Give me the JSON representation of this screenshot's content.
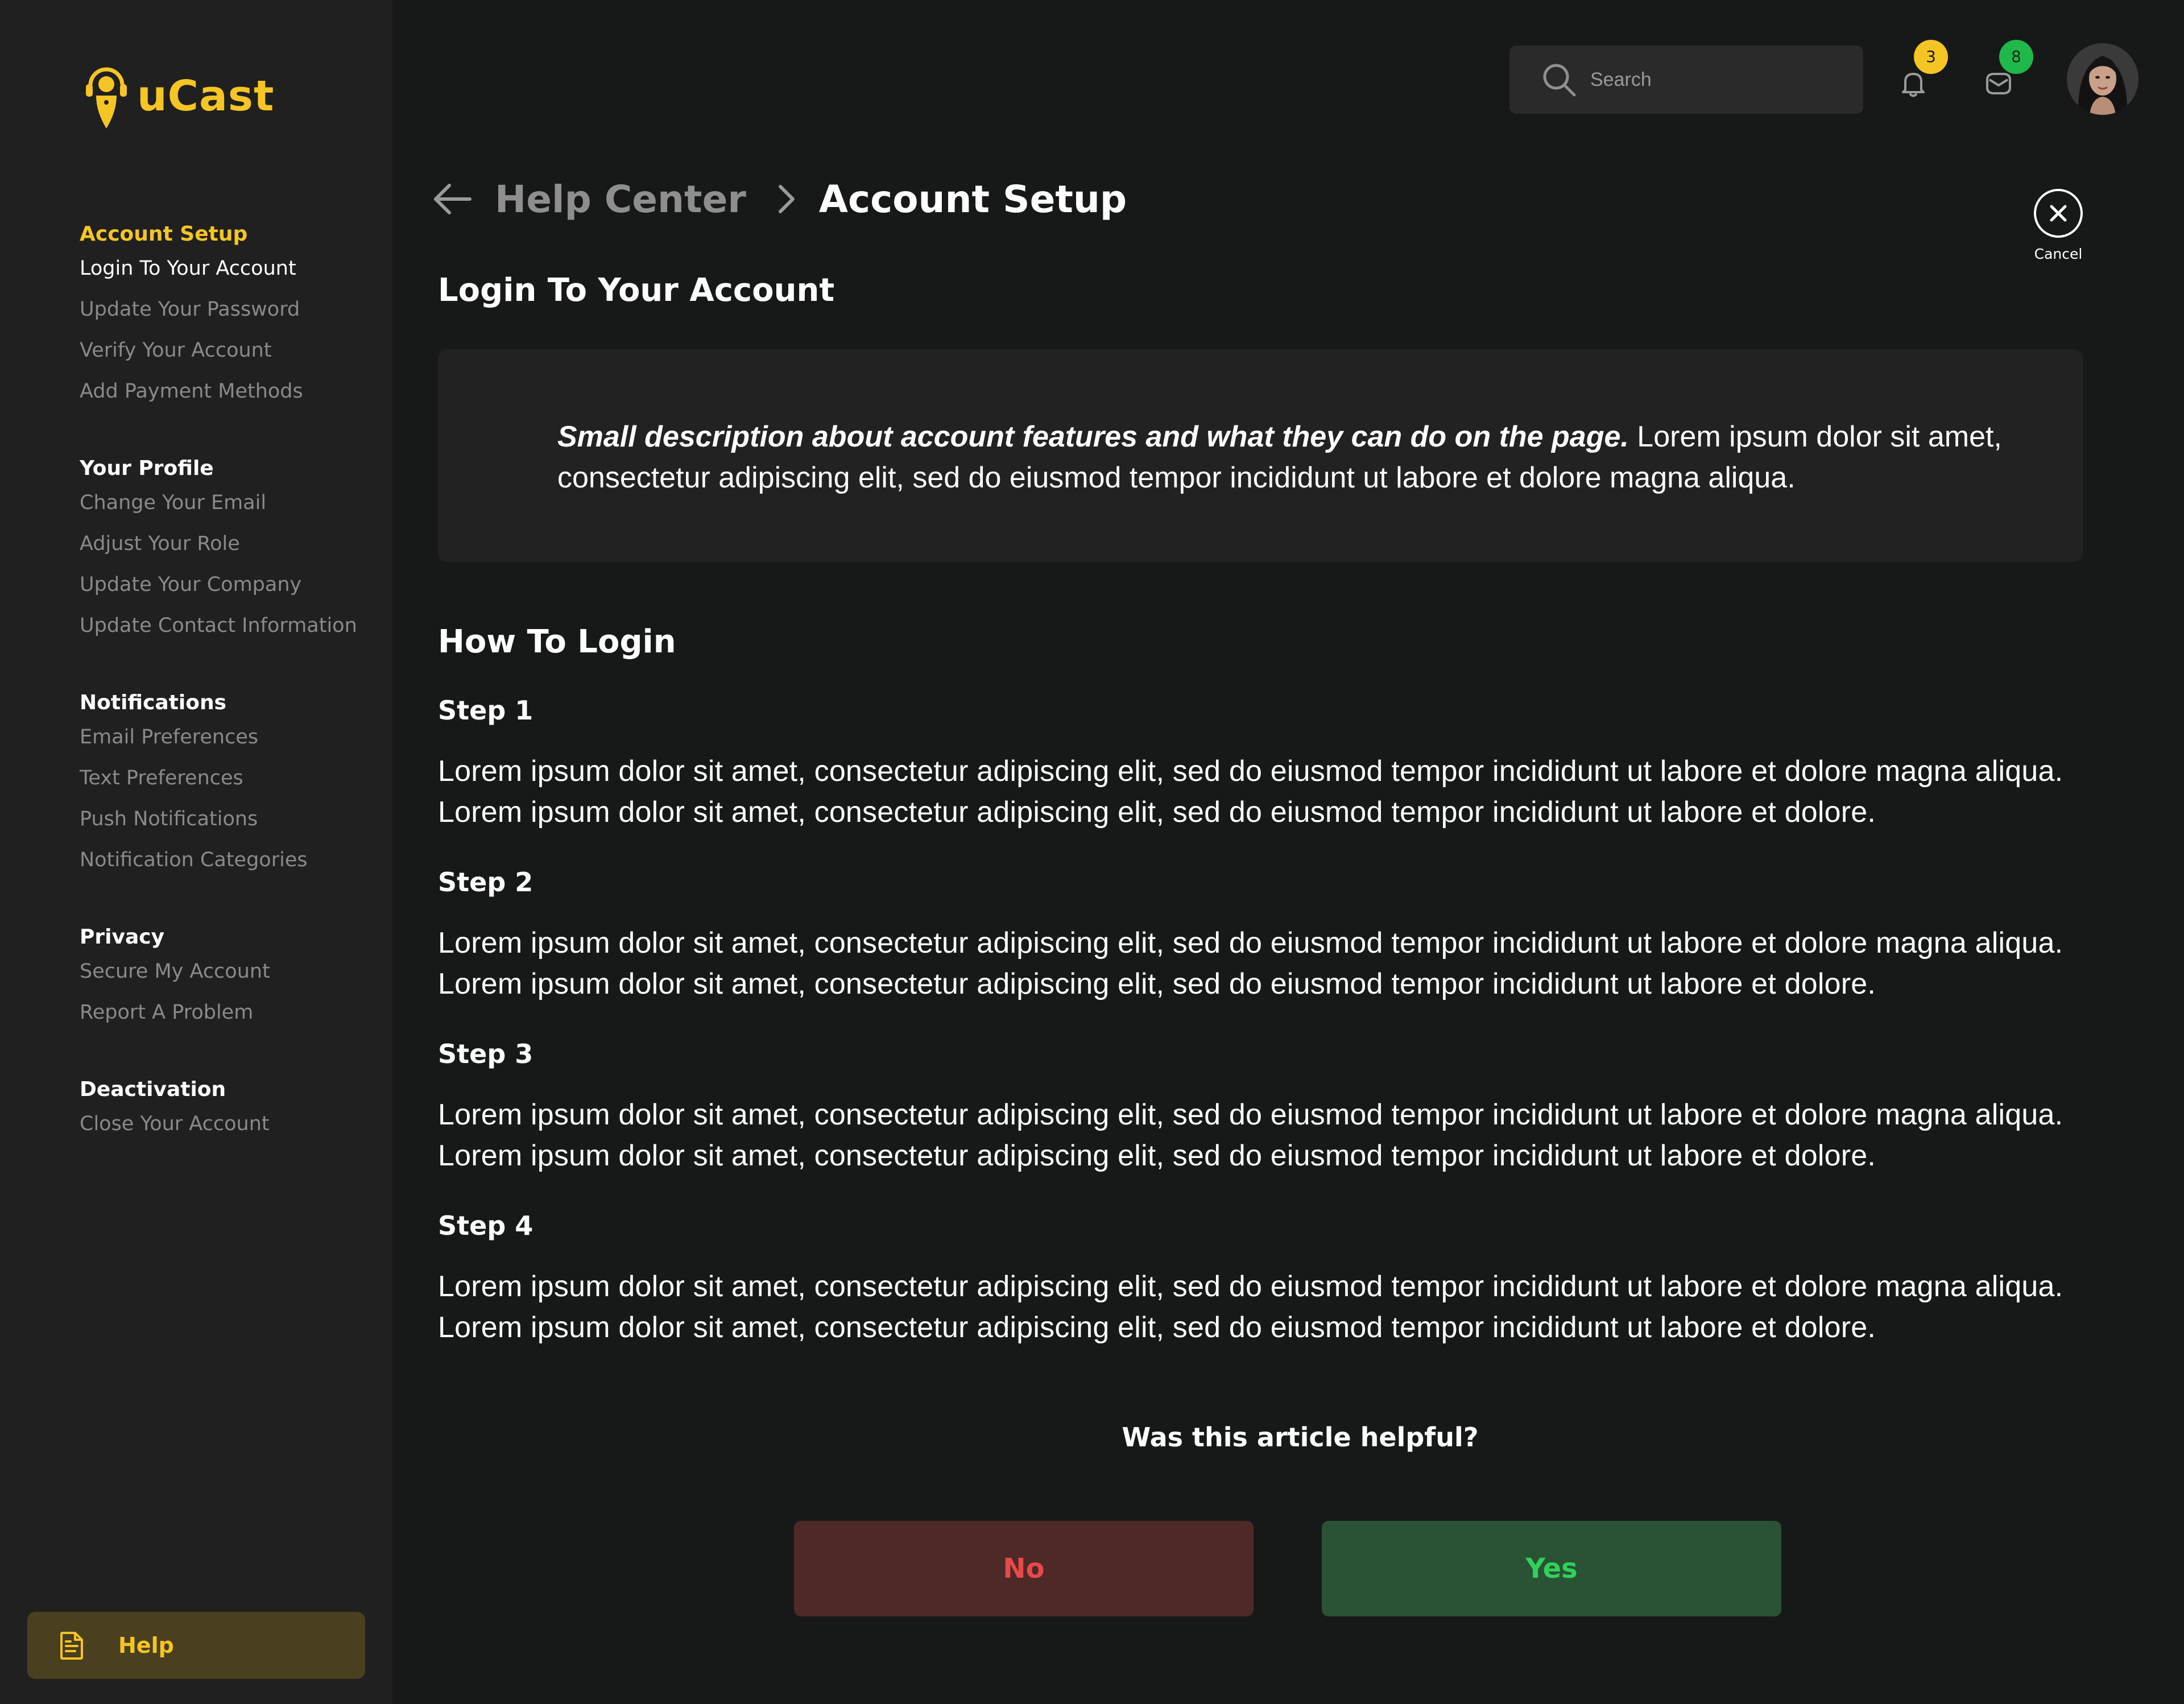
{
  "brand": {
    "name": "uCast",
    "accent": "#f5c524"
  },
  "sidebar": {
    "groups": [
      {
        "heading": "Account Setup",
        "items": [
          "Login To Your Account",
          "Update Your Password",
          "Verify Your Account",
          "Add Payment Methods"
        ]
      },
      {
        "heading": "Your Profile",
        "items": [
          "Change Your Email",
          "Adjust Your Role",
          "Update Your Company",
          "Update Contact Information"
        ]
      },
      {
        "heading": "Notifications",
        "items": [
          "Email Preferences",
          "Text Preferences",
          "Push Notifications",
          "Notification Categories"
        ]
      },
      {
        "heading": "Privacy",
        "items": [
          "Secure My Account",
          "Report A Problem"
        ]
      },
      {
        "heading": "Deactivation",
        "items": [
          "Close Your Account"
        ]
      }
    ],
    "help_label": "Help"
  },
  "header": {
    "search_placeholder": "Search",
    "notifications_count": "3",
    "messages_count": "8"
  },
  "breadcrumb": {
    "parent": "Help Center",
    "current": "Account Setup"
  },
  "cancel_label": "Cancel",
  "article": {
    "title": "Login To Your Account",
    "description_bold": "Small description about account features and what they can do on the page.",
    "description_rest": " Lorem ipsum dolor sit amet, consectetur adipiscing elit, sed do eiusmod tempor incididunt ut labore et dolore magna aliqua.",
    "section_title": "How To Login",
    "steps": [
      {
        "heading": "Step 1",
        "text": "Lorem ipsum dolor sit amet, consectetur adipiscing elit, sed do eiusmod tempor incididunt ut labore et dolore magna aliqua. Lorem ipsum dolor sit amet, consectetur adipiscing elit, sed do eiusmod tempor incididunt ut labore et dolore."
      },
      {
        "heading": "Step 2",
        "text": "Lorem ipsum dolor sit amet, consectetur adipiscing elit, sed do eiusmod tempor incididunt ut labore et dolore magna aliqua. Lorem ipsum dolor sit amet, consectetur adipiscing elit, sed do eiusmod tempor incididunt ut labore et dolore."
      },
      {
        "heading": "Step 3",
        "text": "Lorem ipsum dolor sit amet, consectetur adipiscing elit, sed do eiusmod tempor incididunt ut labore et dolore magna aliqua. Lorem ipsum dolor sit amet, consectetur adipiscing elit, sed do eiusmod tempor incididunt ut labore et dolore."
      },
      {
        "heading": "Step 4",
        "text": "Lorem ipsum dolor sit amet, consectetur adipiscing elit, sed do eiusmod tempor incididunt ut labore et dolore magna aliqua. Lorem ipsum dolor sit amet, consectetur adipiscing elit, sed do eiusmod tempor incididunt ut labore et dolore."
      }
    ]
  },
  "feedback": {
    "question": "Was this article helpful?",
    "no_label": "No",
    "yes_label": "Yes"
  },
  "icons": {
    "logo": "microphone-pin-icon",
    "search": "search-icon",
    "bell": "bell-icon",
    "mail": "mail-icon",
    "back": "arrow-left-icon",
    "separator": "chevron-right-icon",
    "cancel": "close-circle-icon",
    "help": "document-icon"
  },
  "colors": {
    "no": "#e8494b",
    "yes": "#2fd15a",
    "badge_notifications": "#f5c524",
    "badge_messages": "#1fb84a"
  }
}
